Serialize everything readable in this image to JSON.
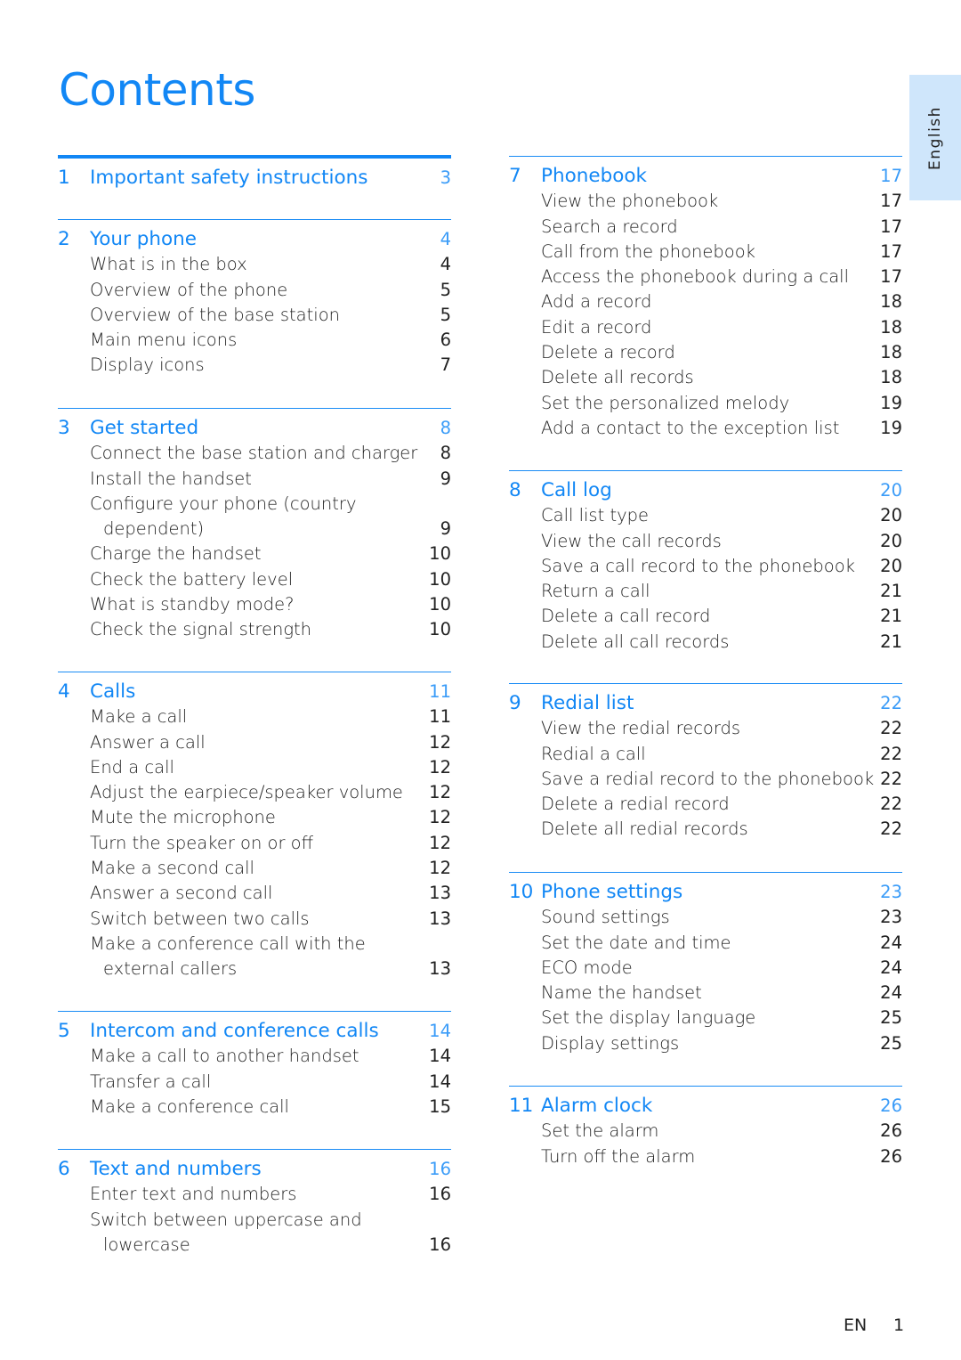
{
  "title": "Contents",
  "language_tab": "English",
  "footer": {
    "lang": "EN",
    "page": "1"
  },
  "left_column": [
    {
      "num": "1",
      "title": "Important safety instructions",
      "page": "3",
      "items": []
    },
    {
      "num": "2",
      "title": "Your phone",
      "page": "4",
      "items": [
        {
          "label": "What is in the box",
          "page": "4"
        },
        {
          "label": "Overview of the phone",
          "page": "5"
        },
        {
          "label": "Overview of the base station",
          "page": "5"
        },
        {
          "label": "Main menu icons",
          "page": "6"
        },
        {
          "label": "Display icons",
          "page": "7"
        }
      ]
    },
    {
      "num": "3",
      "title": "Get started",
      "page": "8",
      "items": [
        {
          "label": "Connect the base station and charger",
          "page": "8"
        },
        {
          "label": "Install the handset",
          "page": "9"
        },
        {
          "label": "Configure your phone (country",
          "page": ""
        },
        {
          "label": "dependent)",
          "page": "9",
          "continuation": true
        },
        {
          "label": "Charge the handset",
          "page": "10"
        },
        {
          "label": "Check the battery level",
          "page": "10"
        },
        {
          "label": "What is standby mode?",
          "page": "10"
        },
        {
          "label": "Check the signal strength",
          "page": "10"
        }
      ]
    },
    {
      "num": "4",
      "title": "Calls",
      "page": "11",
      "items": [
        {
          "label": "Make a call",
          "page": "11"
        },
        {
          "label": "Answer a call",
          "page": "12"
        },
        {
          "label": "End a call",
          "page": "12"
        },
        {
          "label": "Adjust the earpiece/speaker volume",
          "page": "12"
        },
        {
          "label": "Mute the microphone",
          "page": "12"
        },
        {
          "label": "Turn the speaker on or off",
          "page": "12"
        },
        {
          "label": "Make a second call",
          "page": "12"
        },
        {
          "label": "Answer a second call",
          "page": "13"
        },
        {
          "label": "Switch between two calls",
          "page": "13"
        },
        {
          "label": "Make a conference call with the",
          "page": ""
        },
        {
          "label": "external callers",
          "page": "13",
          "continuation": true
        }
      ]
    },
    {
      "num": "5",
      "title": "Intercom and conference calls",
      "page": "14",
      "items": [
        {
          "label": "Make a call to another handset",
          "page": "14"
        },
        {
          "label": "Transfer a call",
          "page": "14"
        },
        {
          "label": "Make a conference call",
          "page": "15"
        }
      ]
    },
    {
      "num": "6",
      "title": "Text and numbers",
      "page": "16",
      "items": [
        {
          "label": "Enter text and numbers",
          "page": "16"
        },
        {
          "label": "Switch between uppercase and",
          "page": ""
        },
        {
          "label": "lowercase",
          "page": "16",
          "continuation": true
        }
      ]
    }
  ],
  "right_column": [
    {
      "num": "7",
      "title": "Phonebook",
      "page": "17",
      "items": [
        {
          "label": "View the phonebook",
          "page": "17"
        },
        {
          "label": "Search a record",
          "page": "17"
        },
        {
          "label": "Call from the phonebook",
          "page": "17"
        },
        {
          "label": "Access the phonebook during a call",
          "page": "17"
        },
        {
          "label": "Add a record",
          "page": "18"
        },
        {
          "label": "Edit a record",
          "page": "18"
        },
        {
          "label": "Delete a record",
          "page": "18"
        },
        {
          "label": "Delete all records",
          "page": "18"
        },
        {
          "label": "Set the personalized melody",
          "page": "19"
        },
        {
          "label": "Add a contact to the exception list",
          "page": "19"
        }
      ]
    },
    {
      "num": "8",
      "title": "Call log",
      "page": "20",
      "items": [
        {
          "label": "Call list type",
          "page": "20"
        },
        {
          "label": "View the call records",
          "page": "20"
        },
        {
          "label": "Save a call record to the phonebook",
          "page": "20"
        },
        {
          "label": "Return a call",
          "page": "21"
        },
        {
          "label": "Delete a call record",
          "page": "21"
        },
        {
          "label": "Delete all call records",
          "page": "21"
        }
      ]
    },
    {
      "num": "9",
      "title": "Redial list",
      "page": "22",
      "items": [
        {
          "label": "View the redial records",
          "page": "22"
        },
        {
          "label": "Redial a call",
          "page": "22"
        },
        {
          "label": "Save a redial record to the phonebook",
          "page": "22"
        },
        {
          "label": "Delete a redial record",
          "page": "22"
        },
        {
          "label": "Delete all redial records",
          "page": "22"
        }
      ]
    },
    {
      "num": "10",
      "title": "Phone settings",
      "page": "23",
      "items": [
        {
          "label": "Sound settings",
          "page": "23"
        },
        {
          "label": "Set the date and time",
          "page": "24"
        },
        {
          "label": "ECO mode",
          "page": "24"
        },
        {
          "label": "Name the handset",
          "page": "24"
        },
        {
          "label": "Set the display language",
          "page": "25"
        },
        {
          "label": "Display settings",
          "page": "25"
        }
      ]
    },
    {
      "num": "11",
      "title": "Alarm clock",
      "page": "26",
      "items": [
        {
          "label": "Set the alarm",
          "page": "26"
        },
        {
          "label": "Turn off the alarm",
          "page": "26"
        }
      ]
    }
  ]
}
